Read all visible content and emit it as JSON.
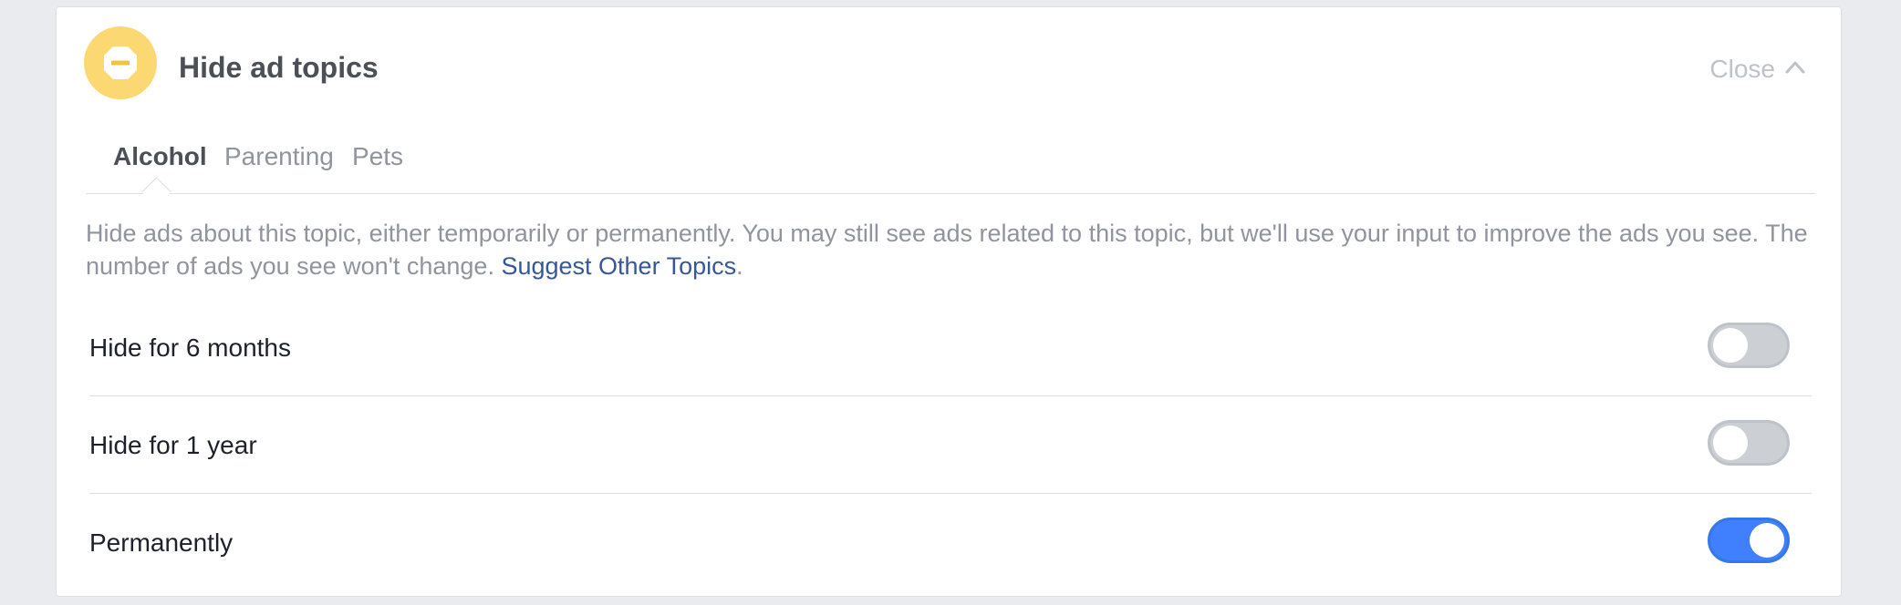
{
  "header": {
    "title": "Hide ad topics",
    "icon": "blocked-sign-icon",
    "close_label": "Close",
    "close_icon": "chevron-up-icon"
  },
  "tabs": [
    {
      "label": "Alcohol",
      "active": true
    },
    {
      "label": "Parenting",
      "active": false
    },
    {
      "label": "Pets",
      "active": false
    }
  ],
  "description": {
    "text": "Hide ads about this topic, either temporarily or permanently. You may still see ads related to this topic, but we'll use your input to improve the ads you see. The number of ads you see won't change. ",
    "link_label": "Suggest Other Topics",
    "trailing": "."
  },
  "options": [
    {
      "label": "Hide for 6 months",
      "enabled": false
    },
    {
      "label": "Hide for 1 year",
      "enabled": false
    },
    {
      "label": "Permanently",
      "enabled": true
    }
  ],
  "colors": {
    "accent": "#4080ff",
    "icon_bg": "#fcd872",
    "link": "#365899"
  }
}
